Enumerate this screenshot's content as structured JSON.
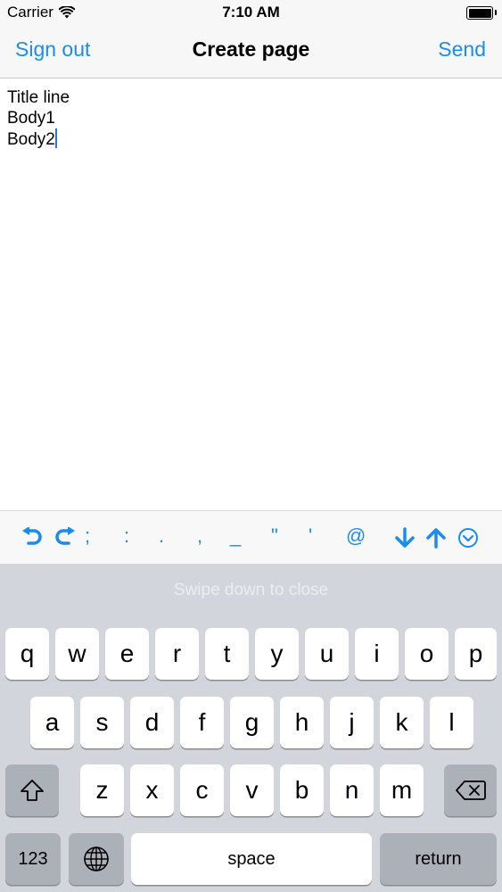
{
  "status": {
    "carrier": "Carrier",
    "time": "7:10 AM"
  },
  "nav": {
    "left_label": "Sign out",
    "title": "Create page",
    "right_label": "Send"
  },
  "editor": {
    "lines": [
      "Title line",
      "Body1",
      "Body2"
    ]
  },
  "toolbar": {
    "items": [
      "undo-icon",
      "redo-icon",
      ";",
      ":",
      ".",
      ",",
      "_",
      "\"",
      "'",
      "@",
      "arrow-down-icon",
      "arrow-up-icon",
      "close-keyboard-icon"
    ],
    "symbols": {
      "semicolon": ";",
      "colon": ":",
      "period": ".",
      "comma": ",",
      "underscore": "_",
      "dquote": "\"",
      "squote": "'",
      "at": "@"
    },
    "accent_color": "#1a8cf0"
  },
  "keyboard": {
    "hint": "Swipe down to close",
    "row1": [
      "q",
      "w",
      "e",
      "r",
      "t",
      "y",
      "u",
      "i",
      "o",
      "p"
    ],
    "row2": [
      "a",
      "s",
      "d",
      "f",
      "g",
      "h",
      "j",
      "k",
      "l"
    ],
    "row3": [
      "z",
      "x",
      "c",
      "v",
      "b",
      "n",
      "m"
    ],
    "numbers_label": "123",
    "space_label": "space",
    "return_label": "return",
    "icons": [
      "shift-icon",
      "backspace-icon",
      "globe-icon"
    ]
  }
}
